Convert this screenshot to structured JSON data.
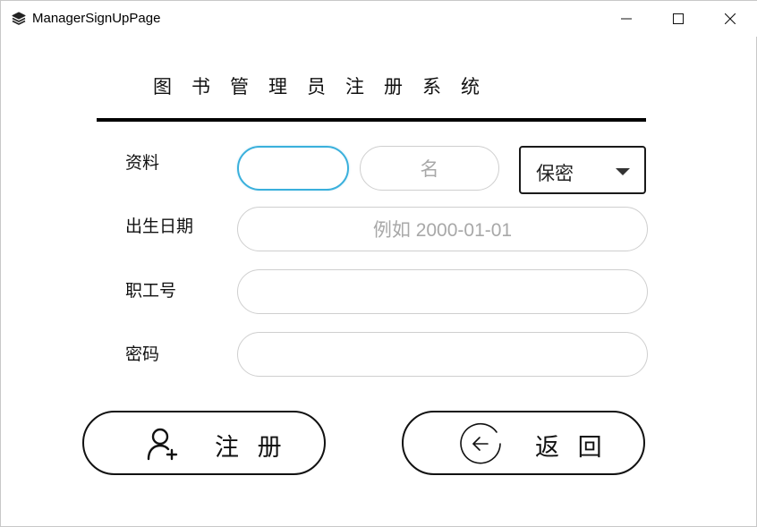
{
  "window": {
    "title": "ManagerSignUpPage",
    "app_icon": "stack-icon",
    "controls": {
      "minimize_icon": "minimize-icon",
      "maximize_icon": "maximize-icon",
      "close_icon": "close-icon"
    }
  },
  "header": {
    "title": "图书管理员注册系统"
  },
  "form": {
    "profile_label": "资料",
    "surname_value": "",
    "surname_placeholder": "",
    "given_name_placeholder": "名",
    "gender_selected": "保密",
    "birthdate_label": "出生日期",
    "birthdate_placeholder": "例如 2000-01-01",
    "employee_id_label": "职工号",
    "employee_id_value": "",
    "password_label": "密码",
    "password_value": ""
  },
  "actions": {
    "register_label": "注 册",
    "register_icon": "add-user-icon",
    "back_label": "返 回",
    "back_icon": "back-arrow-circle-icon"
  },
  "colors": {
    "focus_border": "#3ab0dc",
    "input_border": "#cfcfcf",
    "placeholder": "#a8a8a8",
    "rule": "#000000"
  }
}
